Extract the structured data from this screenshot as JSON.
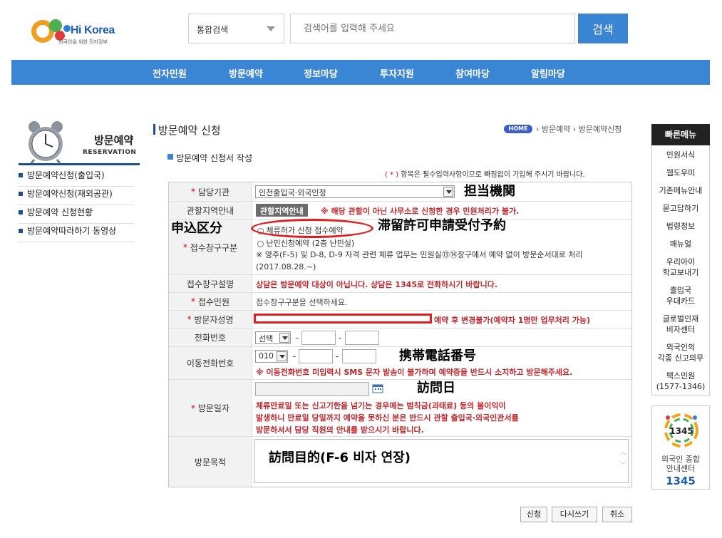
{
  "header": {
    "logo_text": "Hi Korea",
    "logo_sub": "외국인을 위한 전자정부",
    "search_scope": "통합검색",
    "search_placeholder": "검색어를 입력해 주세요",
    "search_button": "검색"
  },
  "gnb": [
    "전자민원",
    "방문예약",
    "정보마당",
    "투자지원",
    "참여마당",
    "알림마당"
  ],
  "sidebar": {
    "title": "방문예약",
    "subtitle": "RESERVATION",
    "items": [
      "방문예약신청(출입국)",
      "방문예약신청(재외공관)",
      "방문예약 신청현황",
      "방문예약따라하기 동영상"
    ]
  },
  "content": {
    "page_title": "방문예약 신청",
    "breadcrumb_home": "HOME",
    "breadcrumb": "› 방문예약 › 방문예약신청",
    "section_title": "방문예약 신청서 작성",
    "notice_star": "( * )",
    "notice": "항목은 필수입력사항이므로 빠짐없이 기입해 주시기 바랍니다."
  },
  "form": {
    "star": "*",
    "agency_label": "담당기관",
    "agency_value": "인천출입국·외국인청",
    "region_label": "관할지역안내",
    "region_button": "관할지역안내",
    "region_note": "※ 해당 관할이 아닌 사무소로 신청한 경우 민원처리가 불가.",
    "window_label": "접수창구구분",
    "window_opt1": "체류허가 신청 접수예약",
    "window_opt2": "난민신청예약 (2층 난민실)",
    "window_note": "※ 영주(F-5) 및 D-8, D-9 자격 관련 체류 업무는 민원실⑬⑭창구에서 예약 없이 방문순서대로 처리(2017.08.28.~)",
    "window_desc_label": "접수창구설명",
    "window_desc": "상담은 방문예약 대상이 아닙니다. 상담은 1345로 전화하시기 바랍니다.",
    "civil_label": "접수민원",
    "civil_value": "접수창구구분을 선택하세요.",
    "name_label": "방문자성명",
    "name_note": "예약 후 변경불가(예약자 1명만 업무처리 가능)",
    "phone_label": "전화번호",
    "phone_select": "선택",
    "mobile_label": "이동전화번호",
    "mobile_prefix": "010",
    "mobile_note": "※ 이동전화번호 미입력시 SMS 문자 발송이 불가하며 예약증을 반드시 소지하고 방문해주세요.",
    "date_label": "방문일자",
    "date_note1": "체류만료일 또는 신고기한을 넘기는 경우에는 범칙금(과태료) 등의 불이익이",
    "date_note2": "발생하니 만료일 당일까지 예약을 못하신 분은 반드시 관할 출입국·외국인관서를",
    "date_note3": "방문하셔서 담당 직원의 안내를 받으시기 바랍니다.",
    "purpose_label": "방문목적",
    "dash": "-"
  },
  "annotations": {
    "agency": "担当機関",
    "apply_type": "申込区分",
    "reservation": "滞留許可申請受付予約",
    "mobile": "携帯電話番号",
    "date": "訪問日",
    "purpose": "訪問目的(F-6 비자 연장)"
  },
  "buttons": {
    "apply": "신청",
    "rewrite": "다시쓰기",
    "cancel": "취소"
  },
  "quick_menu": {
    "title": "빠른메뉴",
    "items": [
      "민원서식",
      "웹도우미",
      "기존메뉴안내",
      "묻고답하기",
      "법령정보",
      "매뉴얼",
      "우리아이\n학교보내기",
      "출입국\n우대카드",
      "글로벌인재\n비자센터",
      "외국인의\n각종 신고의무",
      "팩스민원\n(1577-1346)"
    ],
    "center_logo_num": "1345",
    "center_name": "외국인 종합\n안내센터",
    "center_num": "1345"
  }
}
